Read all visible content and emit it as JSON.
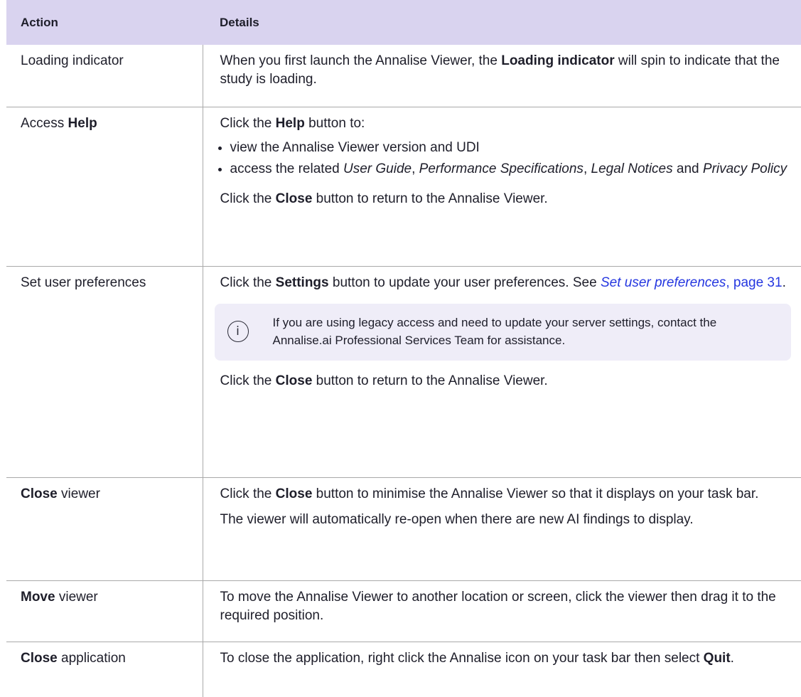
{
  "table": {
    "headers": {
      "action": "Action",
      "details": "Details"
    },
    "rows": {
      "loading": {
        "action": "Loading indicator",
        "details": {
          "t1": "When you first launch the Annalise Viewer, the ",
          "b1": "Loading indicator",
          "t2": " will spin to indicate that the study is loading."
        }
      },
      "help": {
        "action_pre": "Access ",
        "action_bold": "Help",
        "details": {
          "intro_t1": "Click the ",
          "intro_b1": "Help",
          "intro_t2": " button to:",
          "bullet1": "view the Annalise Viewer version and UDI",
          "bullet2_t1": "access the related ",
          "bullet2_i1": "User Guide",
          "bullet2_t2": ", ",
          "bullet2_i2": "Performance Specifications",
          "bullet2_t3": ", ",
          "bullet2_i3": "Legal Notices",
          "bullet2_t4": " and ",
          "bullet2_i4": "Privacy Policy",
          "close_t1": "Click the ",
          "close_b1": "Close",
          "close_t2": " button to return to the Annalise Viewer."
        }
      },
      "settings": {
        "action": "Set user preferences",
        "details": {
          "t1": "Click the ",
          "b1": "Settings",
          "t2": " button to update your user preferences. See ",
          "link_text": "Set user preferences",
          "link_page": ", page 31",
          "t3": ".",
          "note_icon": "info-icon",
          "note_glyph": "i",
          "note": "If you are using legacy access and need to update your server settings, contact the Annalise.ai Professional Services Team for assistance.",
          "close_t1": "Click the ",
          "close_b1": "Close",
          "close_t2": " button to return to the Annalise Viewer."
        }
      },
      "close_viewer": {
        "action_bold": "Close",
        "action_post": " viewer",
        "details": {
          "t1": "Click the ",
          "b1": "Close",
          "t2": " button to minimise the Annalise Viewer so that it displays on your task bar.",
          "p2": "The viewer will automatically re-open when there are new AI findings to display."
        }
      },
      "move_viewer": {
        "action_bold": "Move",
        "action_post": " viewer",
        "details": {
          "t1": "To move the Annalise Viewer to another location or screen, click the viewer then drag it to the required position."
        }
      },
      "close_app": {
        "action_bold": "Close",
        "action_post": " application",
        "details": {
          "t1": "To close the application, right click the Annalise icon on your task bar then select ",
          "b1": "Quit",
          "t2": "."
        }
      }
    }
  },
  "colors": {
    "header_bg": "#d9d3ef",
    "note_bg": "#efedf8",
    "link": "#2537e0",
    "rule": "#a9a9a9"
  }
}
